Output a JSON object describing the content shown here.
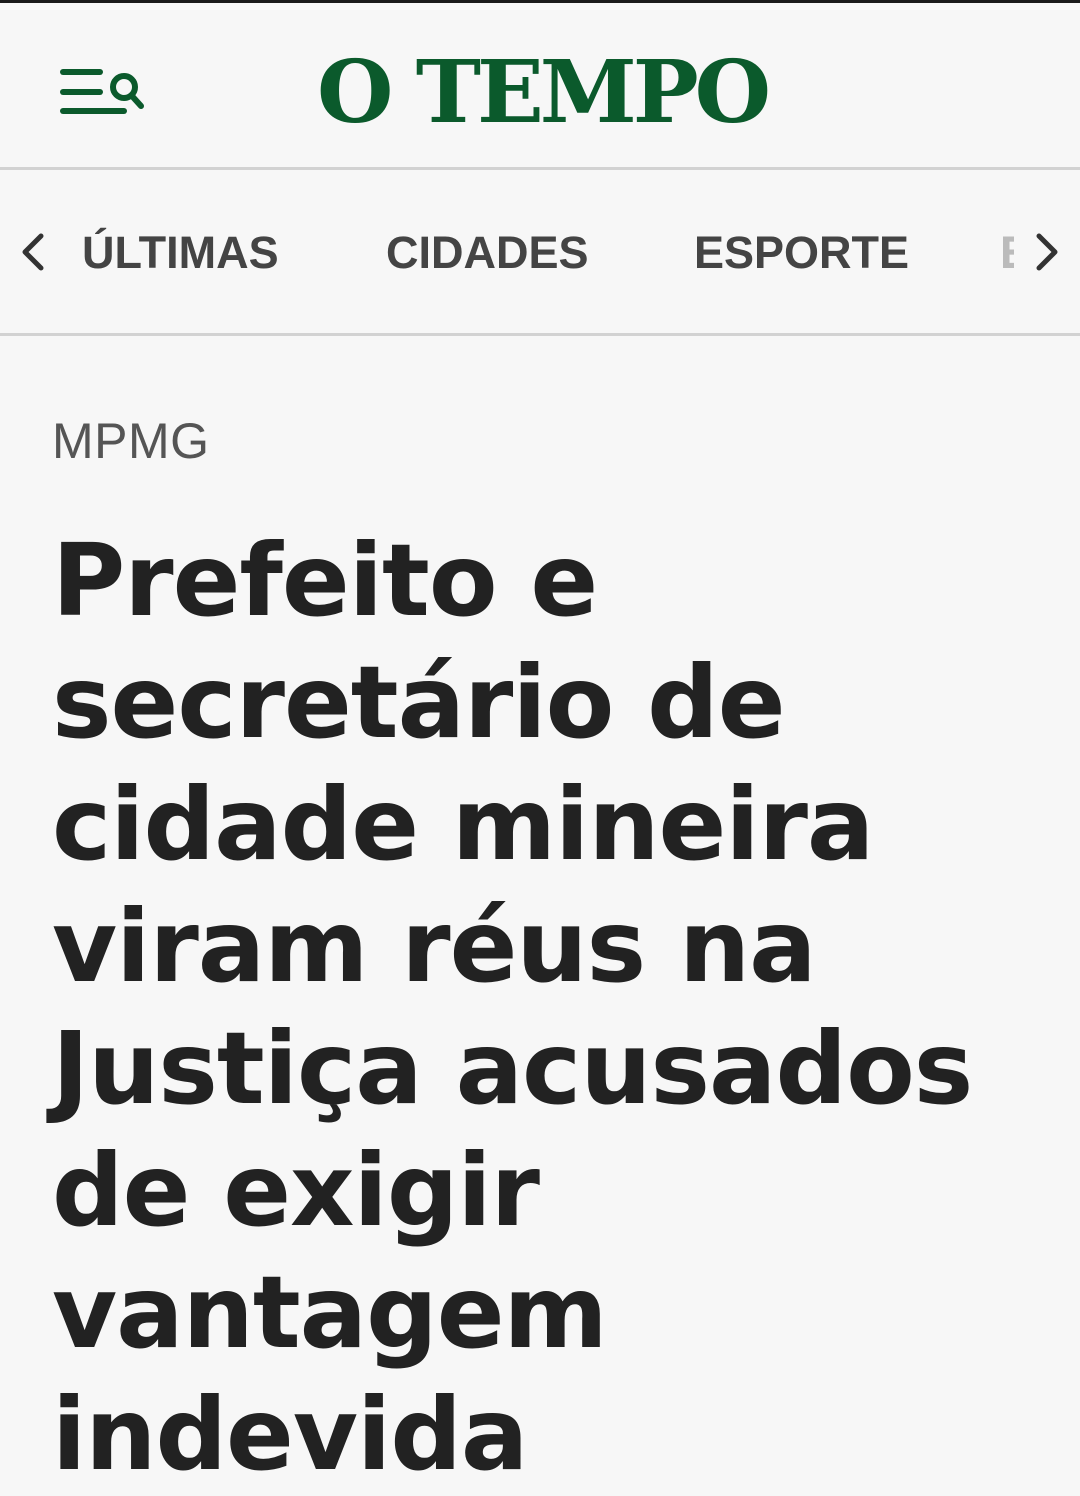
{
  "header": {
    "logo_text": "O TEMPO",
    "menu_icon": "menu-search-icon",
    "brand_color": "#0b5a2c"
  },
  "nav": {
    "prev_icon": "chevron-left-icon",
    "next_icon": "chevron-right-icon",
    "items": [
      {
        "label": "ÚLTIMAS"
      },
      {
        "label": "CIDADES"
      },
      {
        "label": "ESPORTE"
      },
      {
        "label": "E"
      }
    ]
  },
  "article": {
    "category": "MPMG",
    "headline": "Prefeito e secretário de cidade mineira viram réus na Justiça acusados de exigir vantagem indevida"
  }
}
